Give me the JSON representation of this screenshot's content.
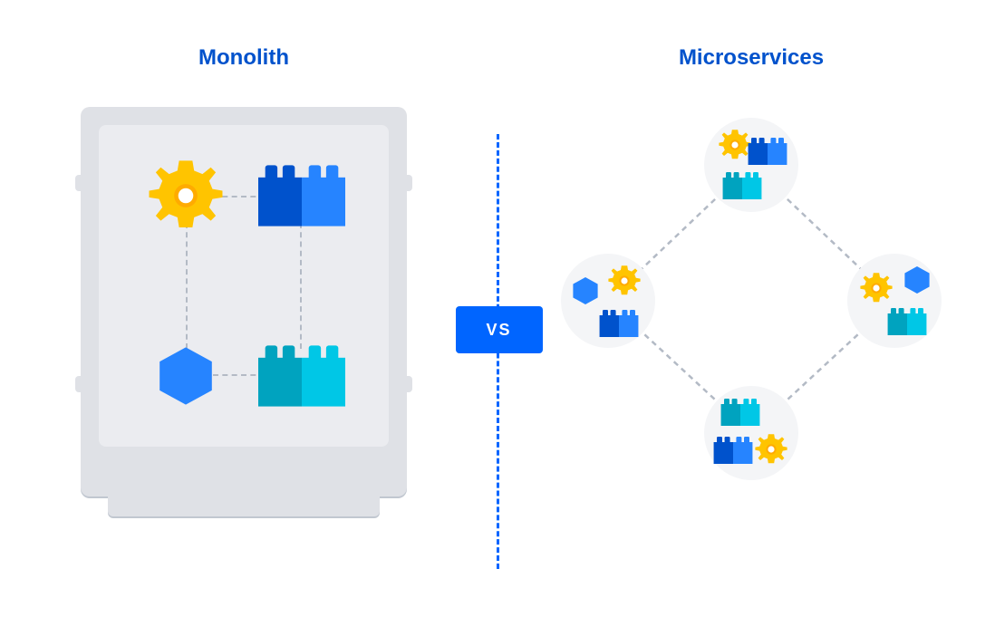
{
  "labels": {
    "left_title": "Monolith",
    "right_title": "Microservices",
    "vs": "VS"
  },
  "colors": {
    "brand_blue": "#0052CC",
    "accent_blue": "#0065FF",
    "gear_yellow": "#FFC400",
    "gear_yellow_dark": "#FFAB00",
    "block_blue_light": "#2684FF",
    "block_blue_dark": "#0052CC",
    "block_teal_light": "#00C7E6",
    "block_teal_dark": "#00A3BF",
    "hexagon_blue": "#2684FF",
    "server_light": "#EBECF0",
    "server_mid": "#DFE1E6",
    "server_dark": "#C1C7D0",
    "dash_gray": "#B3BAC5",
    "circle_bg": "#F4F5F7"
  },
  "diagram": {
    "monolith": {
      "nodes": [
        "gear",
        "block-blue",
        "hexagon",
        "block-teal"
      ],
      "connections": [
        [
          "gear",
          "block-blue"
        ],
        [
          "gear",
          "hexagon"
        ],
        [
          "block-blue",
          "block-teal"
        ],
        [
          "hexagon",
          "block-teal"
        ]
      ]
    },
    "microservices": {
      "nodes": [
        "top",
        "left",
        "right",
        "bottom"
      ],
      "connections": [
        [
          "top",
          "left"
        ],
        [
          "top",
          "right"
        ],
        [
          "left",
          "bottom"
        ],
        [
          "right",
          "bottom"
        ]
      ]
    }
  }
}
